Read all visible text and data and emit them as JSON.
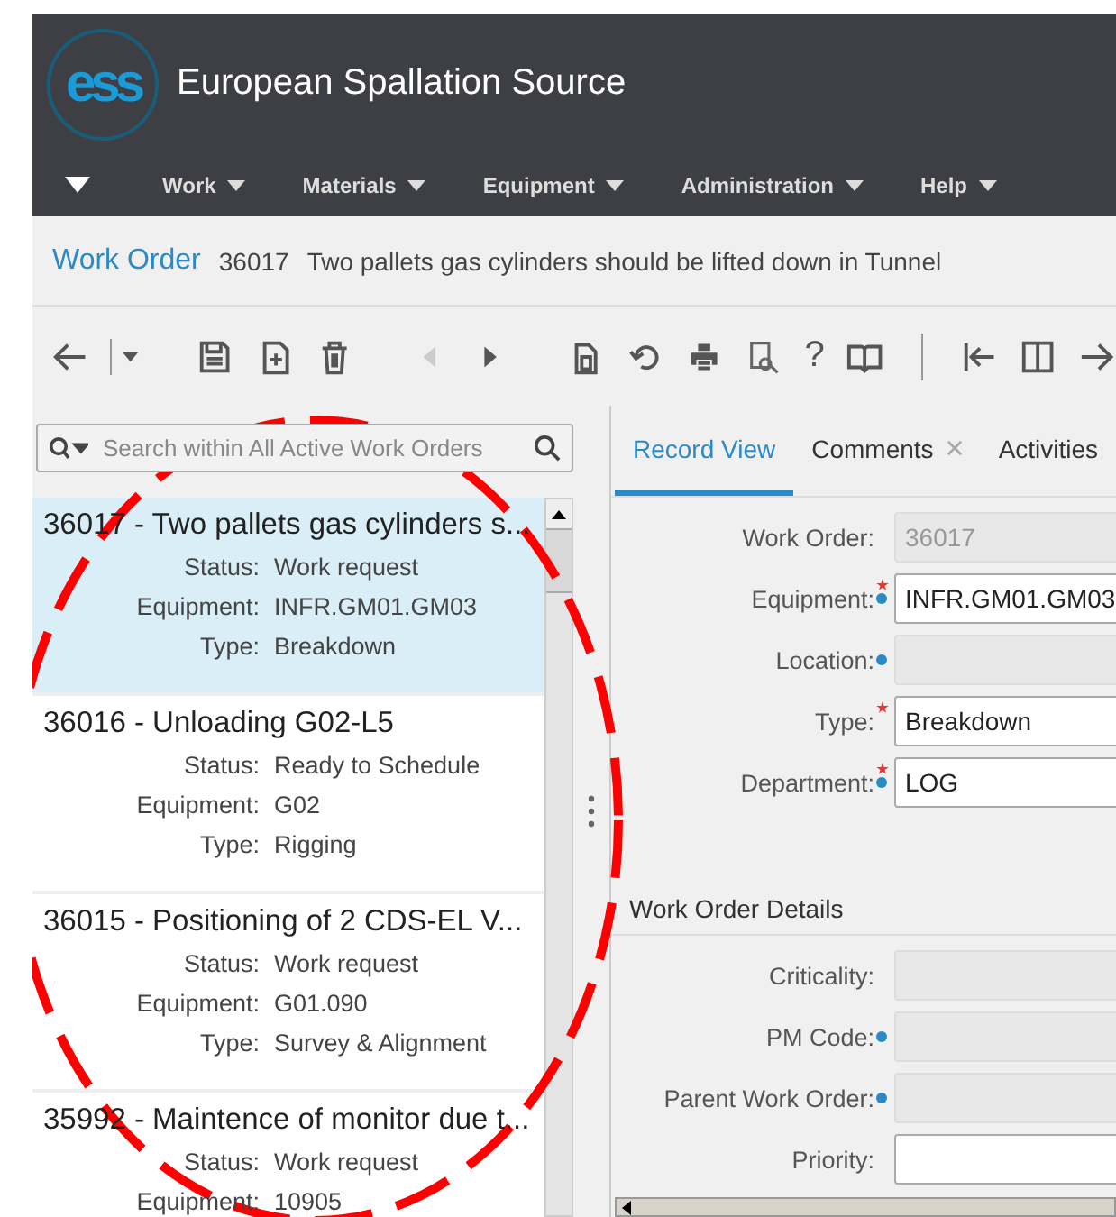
{
  "header": {
    "logo_text": "ess",
    "title": "European Spallation Source"
  },
  "menu": [
    {
      "label": "Work"
    },
    {
      "label": "Materials"
    },
    {
      "label": "Equipment"
    },
    {
      "label": "Administration"
    },
    {
      "label": "Help"
    }
  ],
  "record_title": {
    "module": "Work Order",
    "number": "36017",
    "description": "Two pallets gas cylinders should be lifted down in Tunnel"
  },
  "toolbar": {
    "help_label": "?",
    "previous_disabled": true
  },
  "search": {
    "placeholder": "Search within All Active Work Orders"
  },
  "work_orders": [
    {
      "title": "36017 - Two pallets gas cylinders s...",
      "selected": true,
      "fields": [
        {
          "label": "Status:",
          "value": "Work request"
        },
        {
          "label": "Equipment:",
          "value": "INFR.GM01.GM03"
        },
        {
          "label": "Type:",
          "value": "Breakdown"
        }
      ]
    },
    {
      "title": "36016 - Unloading G02-L5",
      "selected": false,
      "fields": [
        {
          "label": "Status:",
          "value": "Ready to Schedule"
        },
        {
          "label": "Equipment:",
          "value": "G02"
        },
        {
          "label": "Type:",
          "value": "Rigging"
        }
      ]
    },
    {
      "title": "36015 - Positioning of 2 CDS-EL V...",
      "selected": false,
      "fields": [
        {
          "label": "Status:",
          "value": "Work request"
        },
        {
          "label": "Equipment:",
          "value": "G01.090"
        },
        {
          "label": "Type:",
          "value": "Survey & Alignment"
        }
      ]
    },
    {
      "title": "35992 - Maintence of monitor due t...",
      "selected": false,
      "fields": [
        {
          "label": "Status:",
          "value": "Work request"
        },
        {
          "label": "Equipment:",
          "value": "10905"
        }
      ]
    }
  ],
  "tabs": [
    {
      "label": "Record View",
      "selected": true,
      "closable": false
    },
    {
      "label": "Comments",
      "selected": false,
      "closable": true
    },
    {
      "label": "Activities",
      "selected": false,
      "closable": false
    }
  ],
  "form": [
    {
      "label": "Work Order:",
      "value": "36017",
      "required": false,
      "lookup": false,
      "disabled": true
    },
    {
      "label": "Equipment:",
      "value": "INFR.GM01.GM03",
      "required": true,
      "lookup": true,
      "disabled": false
    },
    {
      "label": "Location:",
      "required": false,
      "lookup": true,
      "disabled": true
    },
    {
      "label": "Type:",
      "value": "Breakdown",
      "required": true,
      "lookup": false,
      "disabled": false
    },
    {
      "label": "Department:",
      "value": "LOG",
      "required": true,
      "lookup": true,
      "disabled": false
    }
  ],
  "details": {
    "title": "Work Order Details",
    "fields": [
      {
        "label": "Criticality:",
        "required": false,
        "lookup": false,
        "disabled": true
      },
      {
        "label": "PM Code:",
        "required": false,
        "lookup": true,
        "disabled": true
      },
      {
        "label": "Parent Work Order:",
        "required": false,
        "lookup": true,
        "disabled": true
      },
      {
        "label": "Priority:",
        "required": false,
        "lookup": false,
        "disabled": false
      }
    ]
  }
}
